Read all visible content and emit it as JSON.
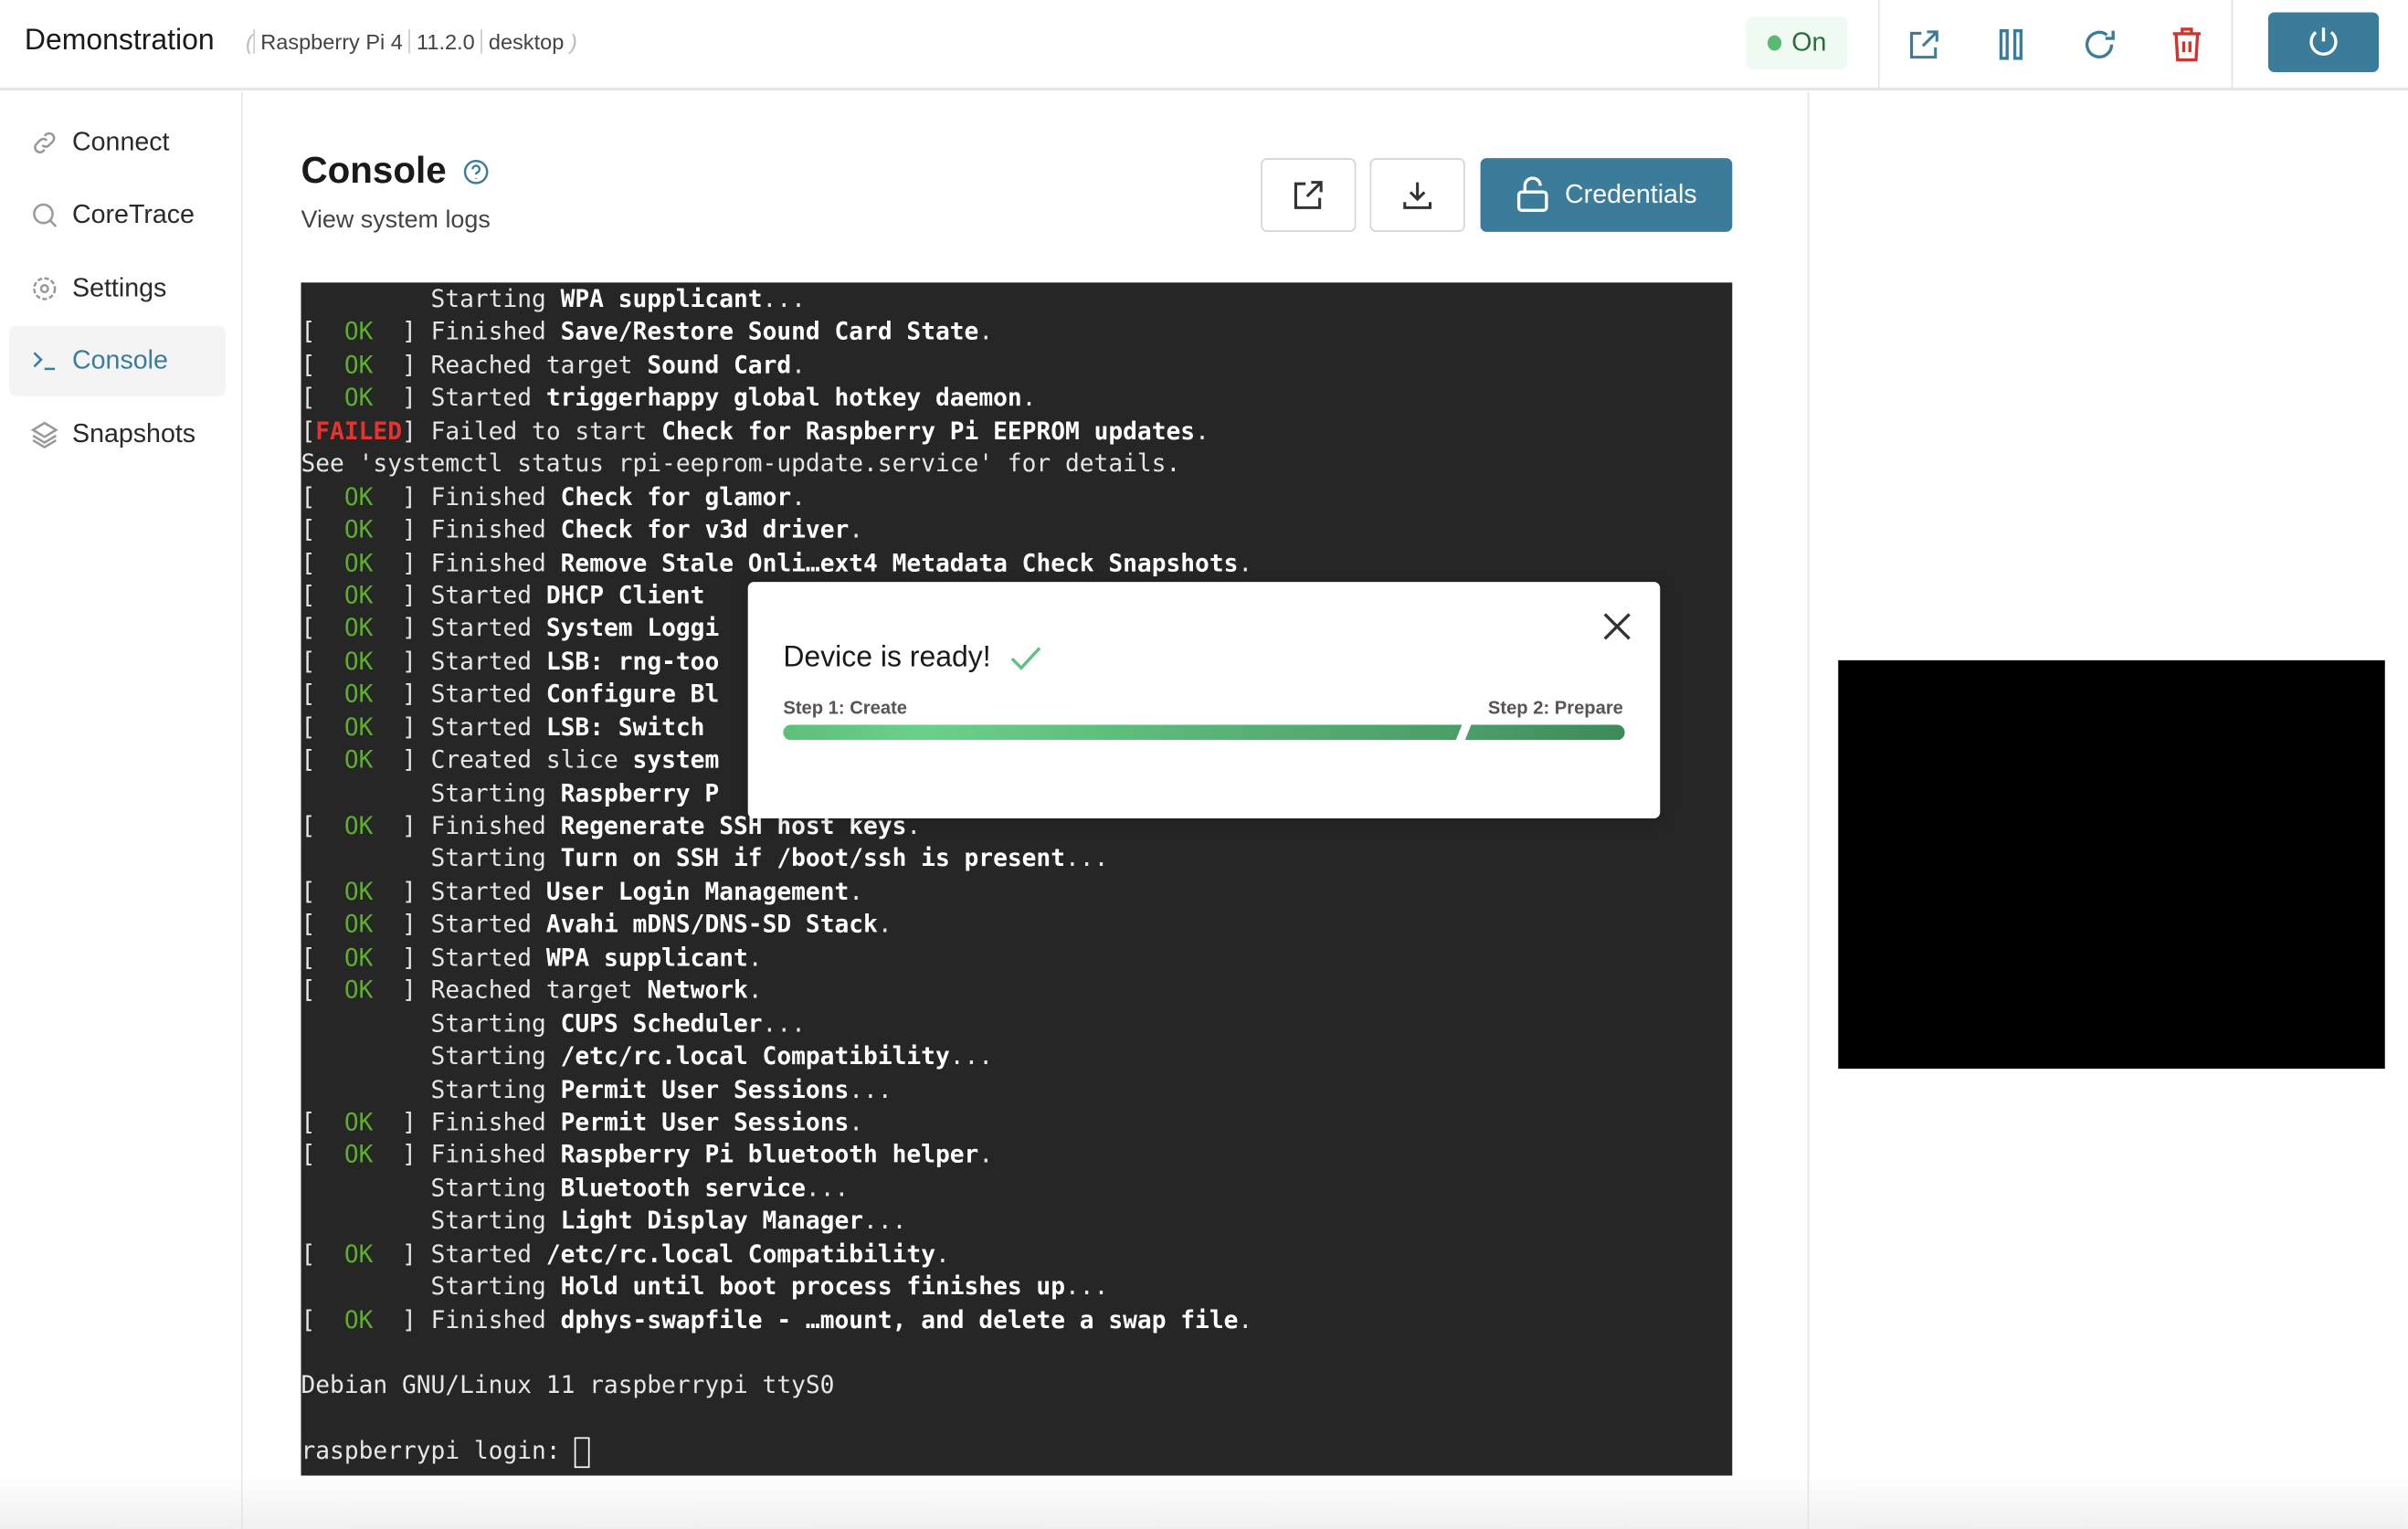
{
  "header": {
    "app_title": "Demonstration",
    "device": "Raspberry Pi 4",
    "version": "11.2.0",
    "mode": "desktop",
    "status": "On",
    "icons": [
      "external-link-icon",
      "pause-icon",
      "refresh-icon",
      "trash-icon",
      "power-icon"
    ]
  },
  "colors": {
    "accent": "#3b7c9b",
    "danger": "#d0342c",
    "ok": "#5bae2e",
    "status_bg": "#effbf2"
  },
  "sidebar": {
    "items": [
      {
        "label": "Connect",
        "icon": "link-icon"
      },
      {
        "label": "CoreTrace",
        "icon": "search-icon"
      },
      {
        "label": "Settings",
        "icon": "gear-icon"
      },
      {
        "label": "Console",
        "icon": "terminal-icon",
        "active": true
      },
      {
        "label": "Snapshots",
        "icon": "layers-icon"
      }
    ]
  },
  "main": {
    "title": "Console",
    "subtitle": "View system logs",
    "credentials_label": "Credentials"
  },
  "terminal": {
    "lines": [
      [
        "",
        "         Starting ",
        "WPA supplicant",
        "..."
      ],
      [
        "OK",
        "Finished ",
        "Save/Restore Sound Card State",
        "."
      ],
      [
        "OK",
        "Reached target ",
        "Sound Card",
        "."
      ],
      [
        "OK",
        "Started ",
        "triggerhappy global hotkey daemon",
        "."
      ],
      [
        "FAILED",
        "Failed to start ",
        "Check for Raspberry Pi EEPROM updates",
        "."
      ],
      [
        "",
        "See 'systemctl status rpi-eeprom-update.service' for details.",
        "",
        ""
      ],
      [
        "OK",
        "Finished ",
        "Check for glamor",
        "."
      ],
      [
        "OK",
        "Finished ",
        "Check for v3d driver",
        "."
      ],
      [
        "OK",
        "Finished ",
        "Remove Stale Onli…ext4 Metadata Check Snapshots",
        "."
      ],
      [
        "OK",
        "Started ",
        "DHCP Client",
        ""
      ],
      [
        "OK",
        "Started ",
        "System Loggi",
        ""
      ],
      [
        "OK",
        "Started ",
        "LSB: rng-too",
        ""
      ],
      [
        "OK",
        "Started ",
        "Configure Bl",
        ""
      ],
      [
        "OK",
        "Started ",
        "LSB: Switch",
        ""
      ],
      [
        "OK",
        "Created slice ",
        "system",
        ""
      ],
      [
        "",
        "         Starting ",
        "Raspberry P",
        ""
      ],
      [
        "OK",
        "Finished ",
        "Regenerate SSH host keys",
        "."
      ],
      [
        "",
        "         Starting ",
        "Turn on SSH if /boot/ssh is present",
        "..."
      ],
      [
        "OK",
        "Started ",
        "User Login Management",
        "."
      ],
      [
        "OK",
        "Started ",
        "Avahi mDNS/DNS-SD Stack",
        "."
      ],
      [
        "OK",
        "Started ",
        "WPA supplicant",
        "."
      ],
      [
        "OK",
        "Reached target ",
        "Network",
        "."
      ],
      [
        "",
        "         Starting ",
        "CUPS Scheduler",
        "..."
      ],
      [
        "",
        "         Starting ",
        "/etc/rc.local Compatibility",
        "..."
      ],
      [
        "",
        "         Starting ",
        "Permit User Sessions",
        "..."
      ],
      [
        "OK",
        "Finished ",
        "Permit User Sessions",
        "."
      ],
      [
        "OK",
        "Finished ",
        "Raspberry Pi bluetooth helper",
        "."
      ],
      [
        "",
        "         Starting ",
        "Bluetooth service",
        "..."
      ],
      [
        "",
        "         Starting ",
        "Light Display Manager",
        "..."
      ],
      [
        "OK",
        "Started ",
        "/etc/rc.local Compatibility",
        "."
      ],
      [
        "",
        "         Starting ",
        "Hold until boot process finishes up",
        "..."
      ],
      [
        "OK",
        "Finished ",
        "dphys-swapfile - …mount, and delete a swap file",
        "."
      ],
      [
        "",
        "",
        "",
        ""
      ],
      [
        "",
        "Debian GNU/Linux 11 raspberrypi ttyS0",
        "",
        ""
      ],
      [
        "",
        "",
        "",
        ""
      ],
      [
        "",
        "raspberrypi login: ",
        "",
        ""
      ]
    ]
  },
  "modal": {
    "title": "Device is ready!",
    "step1": "Step 1: Create",
    "step2": "Step 2: Prepare",
    "progress_percent": 100
  }
}
